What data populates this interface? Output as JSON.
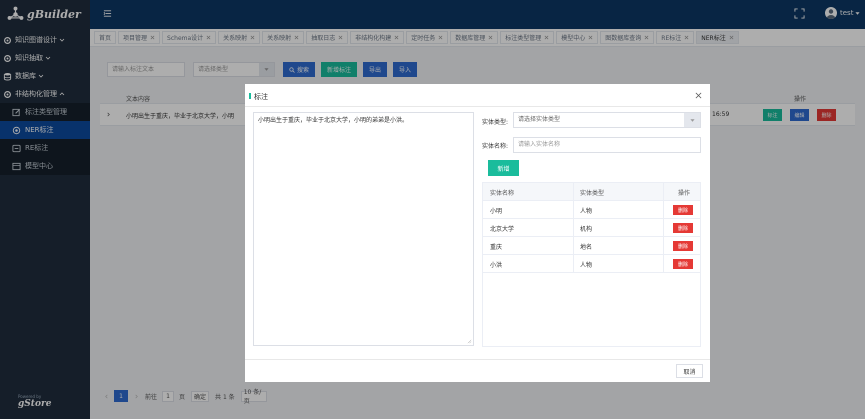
{
  "app": {
    "brand": "gBuilder",
    "powered_small": "Powered by",
    "powered_brand": "gStore"
  },
  "sidebar": {
    "items": [
      {
        "label": "知识图谱设计",
        "icon": "settings-icon"
      },
      {
        "label": "知识抽取",
        "icon": "settings-icon"
      },
      {
        "label": "数据库",
        "icon": "database-icon"
      },
      {
        "label": "非结构化管理",
        "icon": "settings-icon",
        "expanded": true
      }
    ],
    "subitems": [
      {
        "label": "标注类型管理",
        "icon": "edit-icon",
        "active": false
      },
      {
        "label": "NER标注",
        "icon": "target-icon",
        "active": true
      },
      {
        "label": "RE标注",
        "icon": "connect-icon",
        "active": false
      },
      {
        "label": "模型中心",
        "icon": "model-icon",
        "active": false
      }
    ]
  },
  "header": {
    "username": "test"
  },
  "tabs": [
    {
      "label": "首页",
      "closable": false
    },
    {
      "label": "项目管理",
      "closable": true
    },
    {
      "label": "Schema设计",
      "closable": true
    },
    {
      "label": "关系映射",
      "closable": true
    },
    {
      "label": "关系映射",
      "closable": true
    },
    {
      "label": "抽取日志",
      "closable": true
    },
    {
      "label": "非结构化构建",
      "closable": true
    },
    {
      "label": "定时任务",
      "closable": true
    },
    {
      "label": "数据库管理",
      "closable": true
    },
    {
      "label": "标注类型管理",
      "closable": true
    },
    {
      "label": "模型中心",
      "closable": true
    },
    {
      "label": "图数据库查询",
      "closable": true
    },
    {
      "label": "RE标注",
      "closable": true
    },
    {
      "label": "NER标注",
      "closable": true,
      "active": true
    }
  ],
  "toolbar": {
    "search_placeholder": "请输入标注文本",
    "type_placeholder": "请选择类型",
    "search_label": "搜索",
    "new_label": "新增标注",
    "export_label": "导出",
    "import_label": "导入"
  },
  "table": {
    "col_text": "文本内容",
    "col_op": "操作",
    "rows": [
      {
        "text": "小明出生于重庆，毕业于北京大学，小明",
        "time": "16:59",
        "btn_label": "标注",
        "btn_edit": "编辑",
        "btn_delete": "删除"
      }
    ]
  },
  "pagination": {
    "current": "1",
    "goto_text": "前往",
    "page_value": "1",
    "page_unit": "页",
    "confirm": "确定",
    "total": "共 1 条",
    "page_size": "10 条/页"
  },
  "modal": {
    "title": "标注",
    "text": "小明出生于重庆，毕业于北京大学，小明的弟弟是小洪。",
    "type_label": "实体类型:",
    "type_placeholder": "请选择实体类型",
    "name_label": "实体名称:",
    "name_placeholder": "请输入实体名称",
    "add_label": "新增",
    "cancel_label": "取消",
    "table": {
      "headers": [
        "实体名称",
        "实体类型",
        "操作"
      ],
      "delete_label": "删除",
      "rows": [
        {
          "name": "小明",
          "type": "人物"
        },
        {
          "name": "北京大学",
          "type": "机构"
        },
        {
          "name": "重庆",
          "type": "地名"
        },
        {
          "name": "小洪",
          "type": "人物"
        }
      ]
    }
  },
  "colors": {
    "sidebar": "#1f2d3d",
    "header": "#0c3765",
    "active": "#0c4a9e",
    "primary": "#2e6bd0",
    "teal": "#1abc9c",
    "danger": "#e53935"
  }
}
